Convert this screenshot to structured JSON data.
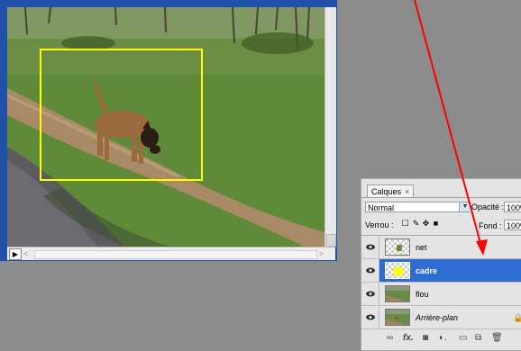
{
  "document": {
    "scroll_left_arrow": "<",
    "scroll_right_arrow": ">",
    "play_icon": "▶"
  },
  "layers_panel": {
    "tab_label": "Calques",
    "tab_close": "×",
    "blend_mode": "Normal",
    "opacity_label": "Opacité :",
    "opacity_value": "100%",
    "lock_label": "Verrou :",
    "fill_label": "Fond :",
    "fill_value": "100%",
    "layers": [
      {
        "name": "net",
        "selected": false,
        "visible": true
      },
      {
        "name": "cadre",
        "selected": true,
        "visible": true
      },
      {
        "name": "flou",
        "selected": false,
        "visible": true
      },
      {
        "name": "Arrière-plan",
        "selected": false,
        "visible": true,
        "locked": true
      }
    ],
    "footer_icons": [
      "link-icon",
      "fx-icon",
      "mask-icon",
      "adjustment-icon",
      "group-icon",
      "new-layer-icon",
      "trash-icon"
    ]
  },
  "annotation": {
    "arrow_color": "#ff0000"
  },
  "colors": {
    "selection_frame": "#ffff00",
    "selected_row": "#2f6cd2",
    "window_border": "#2050a8"
  }
}
